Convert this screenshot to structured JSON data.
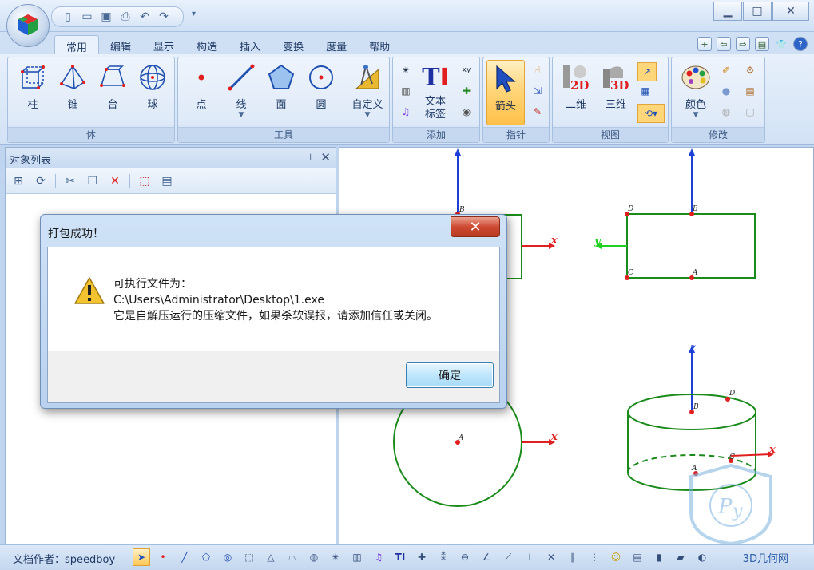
{
  "quick_access": {
    "icons": [
      "new-icon",
      "open-icon",
      "save-icon",
      "print-icon",
      "undo-icon",
      "redo-icon"
    ]
  },
  "tabs": [
    {
      "label": "常用",
      "active": true
    },
    {
      "label": "编辑"
    },
    {
      "label": "显示"
    },
    {
      "label": "构造"
    },
    {
      "label": "插入"
    },
    {
      "label": "变换"
    },
    {
      "label": "度量"
    },
    {
      "label": "帮助"
    }
  ],
  "ribbon": {
    "groups": {
      "solid": "体",
      "tools": "工具",
      "add": "添加",
      "pointer": "指针",
      "view": "视图",
      "modify": "修改"
    },
    "buttons": {
      "prism": "柱",
      "pyramid": "锥",
      "frustum": "台",
      "sphere": "球",
      "point": "点",
      "line": "线",
      "face": "面",
      "circle": "圆",
      "custom": "自定义",
      "text_label": "文本\n标签",
      "arrow": "箭头",
      "view2d": "二维",
      "view3d": "三维",
      "color": "颜色"
    }
  },
  "panel": {
    "title": "对象列表"
  },
  "canvas_labels": {
    "top_left": {
      "axis_x": "x",
      "pt_b": "B"
    },
    "top_right": {
      "axis_y": "y",
      "pt_a": "A",
      "pt_b": "B",
      "pt_c": "C",
      "pt_d": "D"
    },
    "bottom_left": {
      "axis_x": "x",
      "pt": "A"
    },
    "bottom_right": {
      "axis_z": "z",
      "axis_x": "x",
      "pt_a": "A",
      "pt_b": "B",
      "pt_c": "C",
      "pt_d": "D"
    }
  },
  "dialog": {
    "title": "打包成功！",
    "line1": "可执行文件为：",
    "line2": "C:\\Users\\Administrator\\Desktop\\1.exe",
    "line3": "它是自解压运行的压缩文件，如果杀软误报，请添加信任或关闭。",
    "ok": "确定"
  },
  "status": {
    "author": "文档作者：speedboy",
    "brand": "3D几何网"
  },
  "colors": {
    "accent": "#2d5ea8",
    "shape_green": "#1a8a1a",
    "axis_blue": "#1c3fd6",
    "axis_red": "#e02020"
  }
}
